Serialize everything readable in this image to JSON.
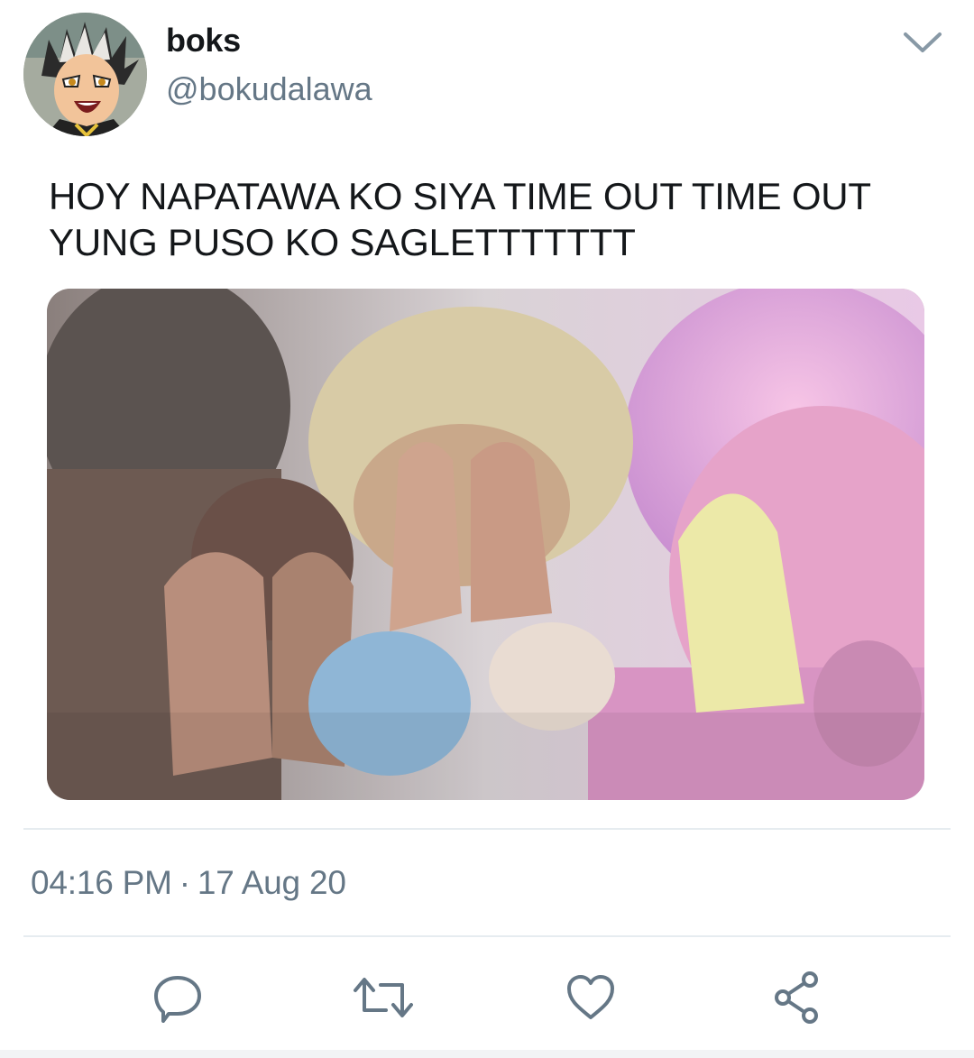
{
  "tweet": {
    "author": {
      "display_name": "boks",
      "handle": "@bokudalawa",
      "avatar_icon": "anime-character-avatar"
    },
    "text": "HOY NAPATAWA KO SIYA TIME OUT TIME OUT\nYUNG PUSO KO SAGLETTTTTTT",
    "media": {
      "description_icon": "meme-image-people-covering-faces"
    },
    "time": "04:16 PM",
    "separator": "·",
    "date": "17 Aug 20"
  },
  "actions": [
    {
      "name": "reply",
      "icon": "reply-icon"
    },
    {
      "name": "retweet",
      "icon": "retweet-icon"
    },
    {
      "name": "like",
      "icon": "heart-icon"
    },
    {
      "name": "share",
      "icon": "share-icon"
    }
  ],
  "colors": {
    "text_primary": "#14171a",
    "text_secondary": "#657786",
    "divider": "#e6ecf0",
    "icon": "#657786"
  }
}
